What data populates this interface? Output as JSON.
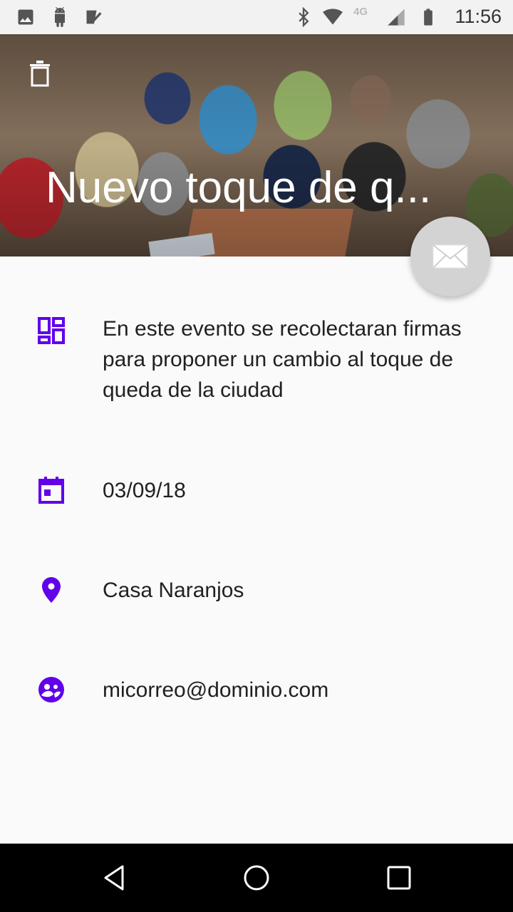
{
  "status_bar": {
    "time": "11:56",
    "network_label": "4G",
    "icons": [
      "image-icon",
      "android-icon",
      "checklist-icon",
      "bluetooth-icon",
      "wifi-icon",
      "signal-icon",
      "battery-icon"
    ]
  },
  "header": {
    "title": "Nuevo toque de q...",
    "delete_icon": "trash-icon"
  },
  "fab": {
    "icon": "envelope-icon",
    "color": "#d3d3d3"
  },
  "details": {
    "description": "En este evento se recolectaran firmas para proponer un cambio al toque de queda de la ciudad",
    "date": "03/09/18",
    "location": "Casa Naranjos",
    "email": "micorreo@dominio.com"
  },
  "theme": {
    "accent": "#6200ea",
    "background": "#fafafa",
    "text": "#212121"
  },
  "nav_bar": {
    "buttons": [
      "back-icon",
      "home-icon",
      "recents-icon"
    ]
  }
}
